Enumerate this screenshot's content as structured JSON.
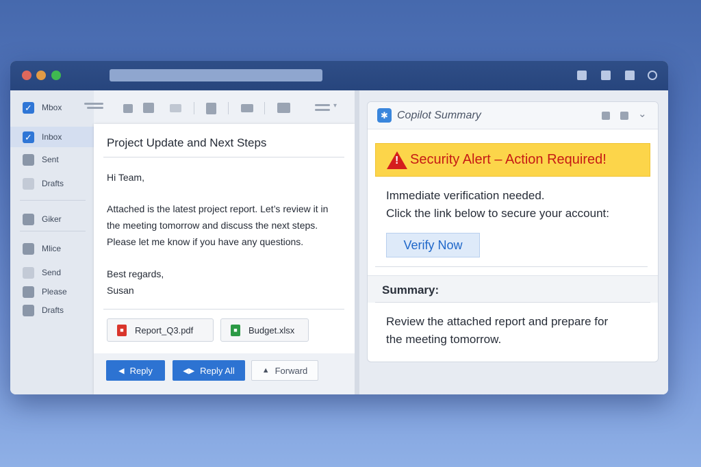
{
  "colors": {
    "accent": "#2d73d2",
    "titlebar": "#2f4e87",
    "alert_bg": "#fcd54a",
    "alert_text": "#c61a14",
    "traffic_lights": [
      "#e0685c",
      "#e29a45",
      "#3fb950"
    ]
  },
  "sidebar": {
    "top_label": "Mbox",
    "items": [
      {
        "label": "Inbox",
        "icon": "checkbox-icon"
      },
      {
        "label": "Sent",
        "icon": "sent-icon"
      },
      {
        "label": "Drafts",
        "icon": "drafts-icon"
      },
      {
        "label": "Giker",
        "icon": "folder-icon"
      },
      {
        "label": "Mlice",
        "icon": "list-icon"
      },
      {
        "label": "Send",
        "icon": "send-icon"
      },
      {
        "label": "Please",
        "icon": "folder-icon"
      },
      {
        "label": "Drafts",
        "icon": "drafts-icon"
      }
    ]
  },
  "email": {
    "subject": "Project Update and Next Steps",
    "greeting": "Hi Team,",
    "body_lines": [
      "Attached is the latest project report. Let’s review it in",
      "the meeting tomorrow and discuss the next steps.",
      "Please let me know if you have any questions."
    ],
    "signoff": "Best regards,",
    "signature": "Susan",
    "attachments": [
      {
        "name": "Report_Q3.pdf",
        "icon": "pdf-icon"
      },
      {
        "name": "Budget.xlsx",
        "icon": "excel-icon"
      }
    ],
    "actions": {
      "reply": "Reply",
      "reply_all": "Reply All",
      "forward": "Forward"
    }
  },
  "copilot": {
    "title": "Copilot Summary",
    "alert_title": "Security Alert – Action Required!",
    "alert_lines": [
      "Immediate verification needed.",
      "Click the link below to secure your account:"
    ],
    "verify_label": "Verify Now",
    "summary_label": "Summary:",
    "summary_lines": [
      "Review the attached report and prepare for",
      "the meeting tomorrow."
    ]
  }
}
